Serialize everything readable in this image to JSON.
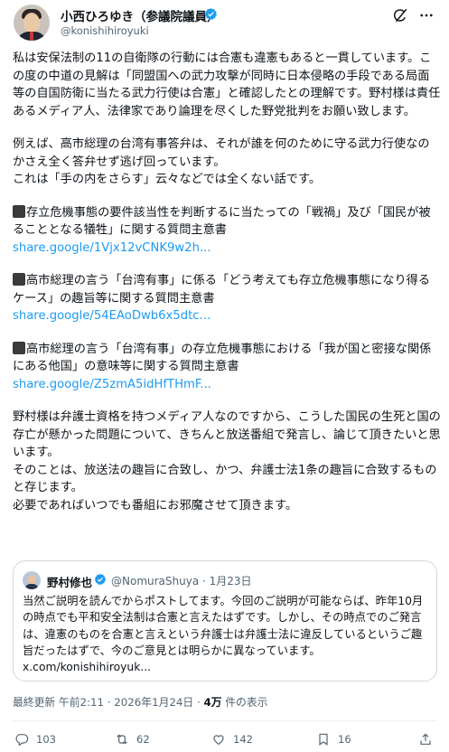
{
  "author": {
    "display_name": "小西ひろゆき（参議院議員）",
    "handle": "@konishihiroyuki"
  },
  "post": {
    "para1": "私は安保法制の11の自衛隊の行動には合憲も違憲もあると一貫しています。この度の中道の見解は「同盟国への武力攻撃が同時に日本侵略の手段である局面等の自国防衛に当たる武力行使は合憲」と確認したとの理解です。野村様は責任あるメディア人、法律家であり論理を尽くした野党批判をお願い致します。",
    "para2": "例えば、高市総理の台湾有事答弁は、それが誰を何のために守る武力行使なのかさえ全く答弁せず逃げ回っています。",
    "para2b": "これは「手の内をさらす」云々などでは全くない話です。",
    "item1_text": "存立危機事態の要件該当性を判断するに当たっての「戦禍」及び「国民が被ることとなる犠牲」に関する質問主意書",
    "item1_link": "share.google/1Vjx12vCNK9w2h...",
    "item2_text": "高市総理の言う「台湾有事」に係る「どう考えても存立危機事態になり得るケース」の趣旨等に関する質問主意書",
    "item2_link": "share.google/54EAoDwb6x5dtc...",
    "item3_text": "高市総理の言う「台湾有事」の存立危機事態における「我が国と密接な関係にある他国」の意味等に関する質問主意書",
    "item3_link": "share.google/Z5zmA5idHfTHmF...",
    "para4a": "野村様は弁護士資格を持つメディア人なのですから、こうした国民の生死と国の存亡が懸かった問題について、きちんと放送番組で発言し、論じて頂きたいと思います。",
    "para4b": "そのことは、放送法の趣旨に合致し、かつ、弁護士法1条の趣旨に合致するものと存じます。",
    "para4c": "必要であればいつでも番組にお邪魔させて頂きます。"
  },
  "quote": {
    "name": "野村修也",
    "handle_date": "@NomuraShuya · 1月23日",
    "text": "当然ご説明を読んでからポストしてます。今回のご説明が可能ならば、昨年10月の時点でも平和安全法制は合憲と言えたはずです。しかし、その時点でのご発言は、違憲のものを合憲と言えという弁護士は弁護士法に違反しているというご趣旨だったはずで、今のご意見とは明らかに異なっています。",
    "link": "x.com/konishihiroyuk..."
  },
  "meta": {
    "prefix": "最終更新 午前2:11 · 2026年1月24日 · ",
    "views": "4万",
    "suffix": " 件の表示"
  },
  "actions": {
    "replies": "103",
    "reposts": "62",
    "likes": "142",
    "bookmarks": "16"
  },
  "colors": {
    "accent": "#1d9bf0",
    "text": "#0f1419",
    "secondary": "#536471",
    "border": "#cfd9de"
  },
  "icons": [
    "verified-badge-icon",
    "grok-icon",
    "more-icon",
    "reply-icon",
    "repost-icon",
    "like-icon",
    "bookmark-icon",
    "share-icon"
  ]
}
